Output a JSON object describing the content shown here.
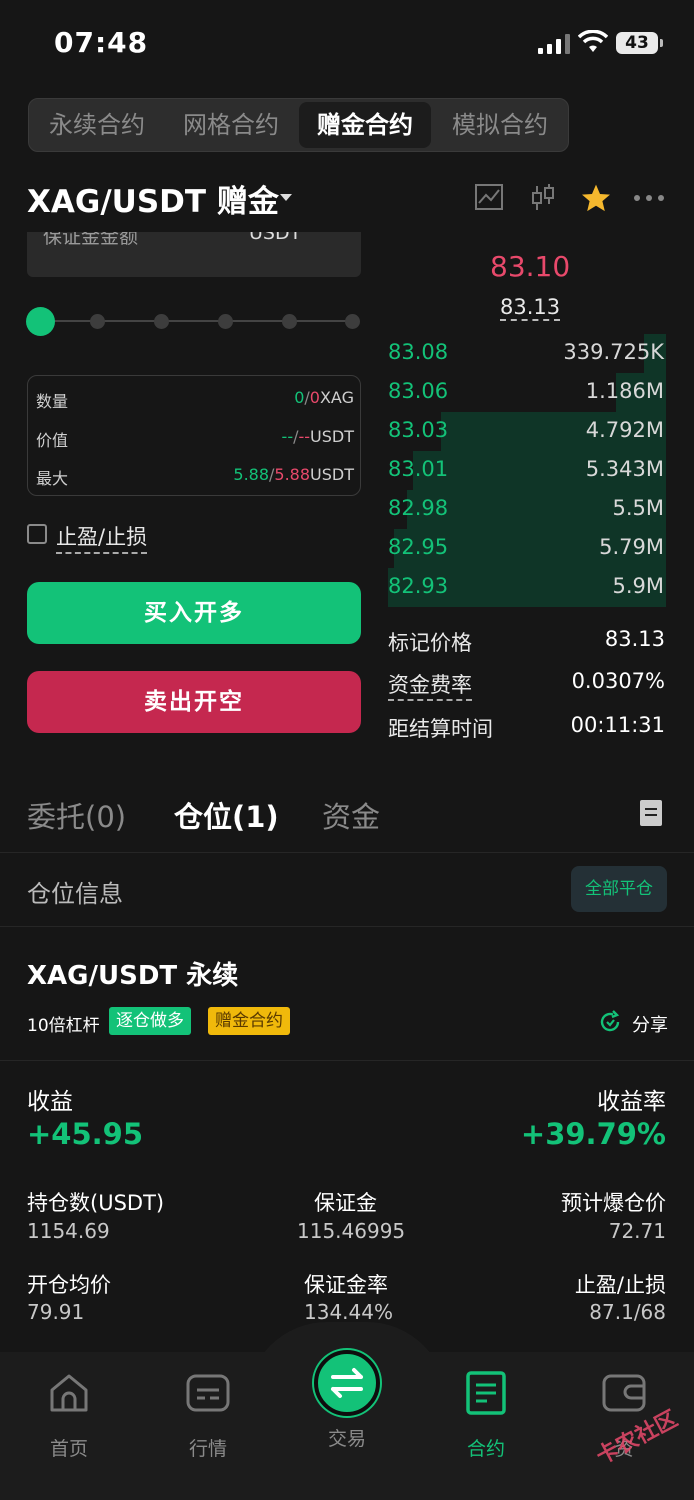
{
  "status_bar": {
    "time": "07:48",
    "battery": "43"
  },
  "segments": [
    "永续合约",
    "网格合约",
    "赠金合约",
    "模拟合约"
  ],
  "active_segment": 2,
  "symbol": {
    "title": "XAG/USDT 赠金"
  },
  "form": {
    "margin_label": "保证金金额",
    "margin_unit": "USDT",
    "slider_percent": 0,
    "qty_label": "数量",
    "qty_a": "0",
    "qty_sep": "/",
    "qty_b": "0",
    "qty_unit": "XAG",
    "value_label": "价值",
    "value_a": "--",
    "value_sep": "/",
    "value_b": "--",
    "value_unit": "USDT",
    "max_label": "最大",
    "max_a": "5.88",
    "max_sep": "/",
    "max_b": "5.88",
    "max_unit": "USDT",
    "tpsl_label": "止盈/止损",
    "buy_label": "买入开多",
    "sell_label": "卖出开空"
  },
  "orderbook": {
    "last_price": "83.10",
    "mark_price": "83.13",
    "bids": [
      {
        "price": "83.08",
        "qty": "339.725K",
        "depth": 0.08
      },
      {
        "price": "83.06",
        "qty": "1.186M",
        "depth": 0.18
      },
      {
        "price": "83.03",
        "qty": "4.792M",
        "depth": 0.81
      },
      {
        "price": "83.01",
        "qty": "5.343M",
        "depth": 0.91
      },
      {
        "price": "82.98",
        "qty": "5.5M",
        "depth": 0.93
      },
      {
        "price": "82.95",
        "qty": "5.79M",
        "depth": 0.98
      },
      {
        "price": "82.93",
        "qty": "5.9M",
        "depth": 1.0
      }
    ],
    "mark_label": "标记价格",
    "mark_value": "83.13",
    "funding_label": "资金费率",
    "funding_value": "0.0307%",
    "settle_label": "距结算时间",
    "settle_value": "00:11:31"
  },
  "tabs": {
    "orders": "委托(0)",
    "positions": "仓位(1)",
    "funds": "资金"
  },
  "positions": {
    "section_title": "仓位信息",
    "close_all": "全部平仓",
    "item": {
      "title": "XAG/USDT 永续",
      "leverage": "10倍杠杆",
      "tag_side": "逐仓做多",
      "tag_type": "赠金合约",
      "share": "分享",
      "pnl_label": "收益",
      "pnl_value": "+45.95",
      "roe_label": "收益率",
      "roe_value": "+39.79%",
      "size_label": "持仓数(USDT)",
      "size_value": "1154.69",
      "margin_label": "保证金",
      "margin_value": "115.46995",
      "liq_label": "预计爆仓价",
      "liq_value": "72.71",
      "entry_label": "开仓均价",
      "entry_value": "79.91",
      "mratio_label": "保证金率",
      "mratio_value": "134.44%",
      "tpsl_label": "止盈/止损",
      "tpsl_value": "87.1/68"
    }
  },
  "nav": [
    "首页",
    "行情",
    "交易",
    "合约",
    "资"
  ],
  "active_nav": 3,
  "watermark": "卡农社区",
  "colors": {
    "green": "#13c278",
    "red": "#e8496b",
    "bg": "#161616",
    "star": "#f5b82e"
  }
}
